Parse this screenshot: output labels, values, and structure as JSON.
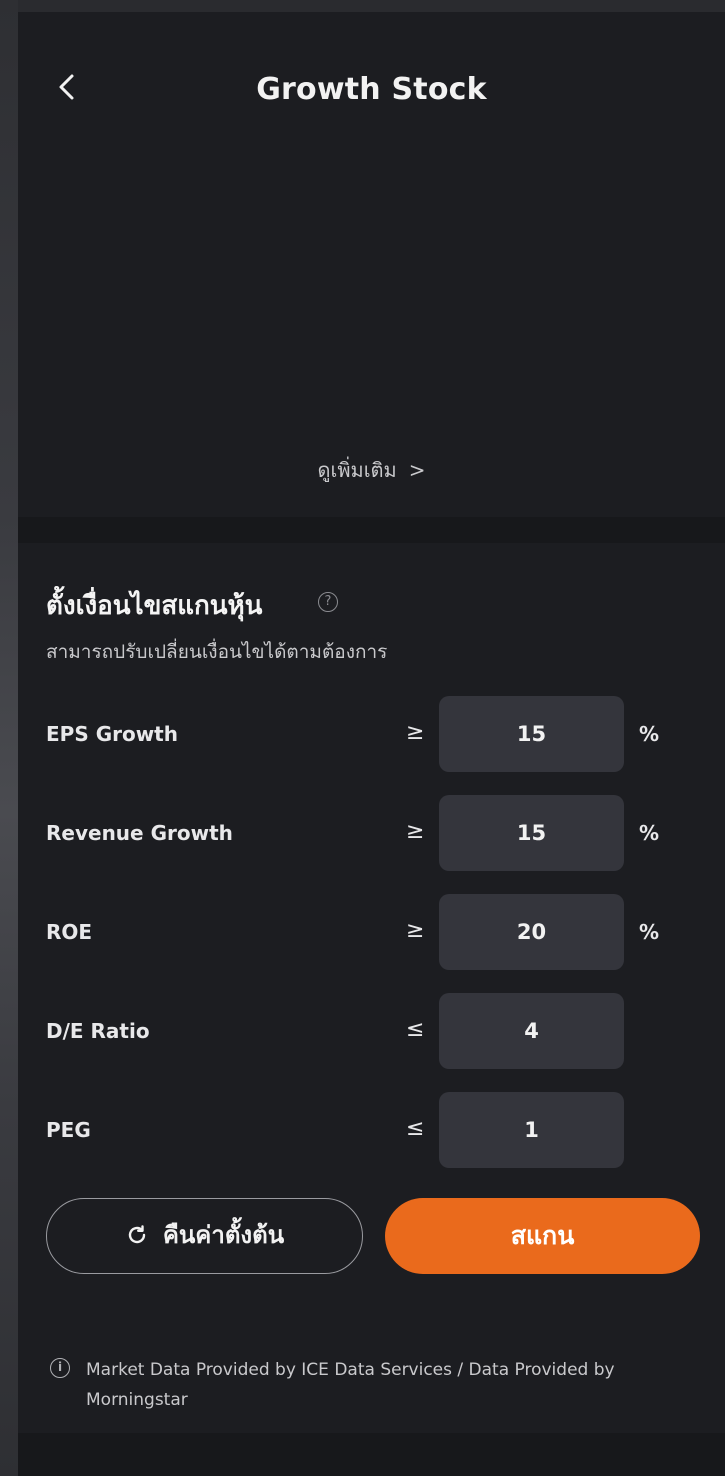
{
  "header": {
    "title": "Growth Stock",
    "see_more_label": "ดูเพิ่มเติม",
    "see_more_chevron": ">"
  },
  "criteria": {
    "title": "ตั้งเงื่อนไขสแกนหุ้น",
    "help_symbol": "?",
    "subtitle": "สามารถปรับเปลี่ยนเงื่อนไขได้ตามต้องการ",
    "rows": [
      {
        "label": "EPS Growth",
        "op": "≥",
        "value": "15",
        "unit": "%"
      },
      {
        "label": "Revenue Growth",
        "op": "≥",
        "value": "15",
        "unit": "%"
      },
      {
        "label": "ROE",
        "op": "≥",
        "value": "20",
        "unit": "%"
      },
      {
        "label": "D/E Ratio",
        "op": "≤",
        "value": "4",
        "unit": ""
      },
      {
        "label": "PEG",
        "op": "≤",
        "value": "1",
        "unit": ""
      }
    ]
  },
  "actions": {
    "reset_label": "คืนค่าตั้งต้น",
    "scan_label": "สแกน"
  },
  "disclaimer": {
    "info_symbol": "i",
    "text": "Market Data Provided by ICE Data Services / Data Provided by Morningstar"
  },
  "colors": {
    "background": "#1c1d21",
    "input_box": "#34353c",
    "accent": "#ea6a1c"
  },
  "icons": {
    "back": "chevron-left-icon",
    "help": "question-circle-icon",
    "reset": "refresh-icon",
    "info": "info-circle-icon"
  }
}
